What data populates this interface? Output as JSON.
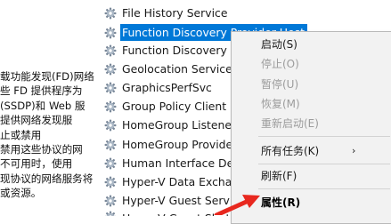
{
  "description_lines": [
    "载功能发现(FD)网络",
    "些 FD 提供程序为",
    "(SSDP)和 Web 服",
    "提供网络发现服",
    "止或禁用",
    "禁用这些协议的网",
    "不可用时，使用",
    "现协议的网络服务将",
    "或资源。"
  ],
  "services": [
    {
      "name": "File History Service"
    },
    {
      "name": "Function Discovery Provider Host"
    },
    {
      "name": "Function Discovery Re"
    },
    {
      "name": "Geolocation Service"
    },
    {
      "name": "GraphicsPerfSvc"
    },
    {
      "name": "Group Policy Client"
    },
    {
      "name": "HomeGroup Listener"
    },
    {
      "name": "HomeGroup Provider"
    },
    {
      "name": "Human Interface Dev"
    },
    {
      "name": "Hyper-V Data Exchan"
    },
    {
      "name": "Hyper-V Guest Servic"
    },
    {
      "name": "Hyper-V Guest Shut"
    }
  ],
  "selected_service_index": 1,
  "context_menu": {
    "start": "启动(S)",
    "stop": "停止(O)",
    "pause": "暂停(U)",
    "resume": "恢复(M)",
    "restart": "重新启动(E)",
    "all_tasks": "所有任务(K)",
    "refresh": "刷新(F)",
    "properties": "属性(R)",
    "submenu_arrow": "›"
  },
  "colors": {
    "selection": "#0078d7",
    "arrow": "#e8281f",
    "disabled_text": "#9c9c9c"
  }
}
